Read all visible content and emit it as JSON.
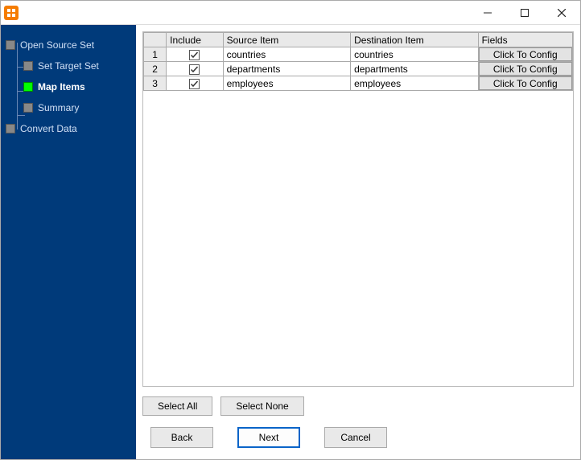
{
  "window": {
    "title": ""
  },
  "sidebar": {
    "items": [
      {
        "label": "Open Source Set",
        "level": 0,
        "active": false
      },
      {
        "label": "Set Target Set",
        "level": 1,
        "active": false
      },
      {
        "label": "Map Items",
        "level": 1,
        "active": true
      },
      {
        "label": "Summary",
        "level": 1,
        "active": false
      },
      {
        "label": "Convert Data",
        "level": 0,
        "active": false
      }
    ]
  },
  "table": {
    "headers": {
      "rownum": "",
      "include": "Include",
      "source": "Source Item",
      "destination": "Destination Item",
      "fields": "Fields"
    },
    "rows": [
      {
        "num": "1",
        "include": true,
        "source": "countries",
        "destination": "countries",
        "fields_btn": "Click To Config"
      },
      {
        "num": "2",
        "include": true,
        "source": "departments",
        "destination": "departments",
        "fields_btn": "Click To Config"
      },
      {
        "num": "3",
        "include": true,
        "source": "employees",
        "destination": "employees",
        "fields_btn": "Click To Config"
      }
    ]
  },
  "buttons": {
    "select_all": "Select All",
    "select_none": "Select None",
    "back": "Back",
    "next": "Next",
    "cancel": "Cancel"
  }
}
